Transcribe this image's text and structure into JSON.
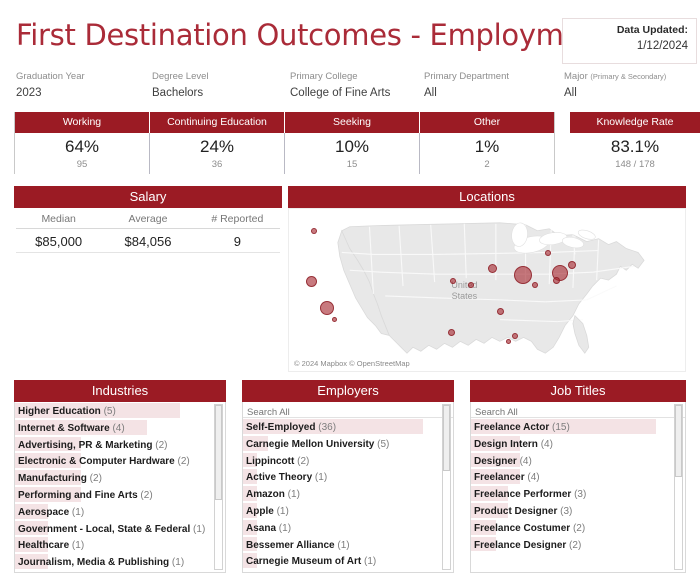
{
  "header": {
    "title": "First Destination Outcomes - Employment",
    "updated_label": "Data Updated:",
    "updated_value": "1/12/2024",
    "accent_red": "#9B1B24",
    "title_red": "#AA2B38",
    "highlight_pink": "#F4E3E5"
  },
  "filters": [
    {
      "label": "Graduation Year",
      "sub": "",
      "value": "2023"
    },
    {
      "label": "Degree Level",
      "sub": "",
      "value": "Bachelors"
    },
    {
      "label": "Primary College",
      "sub": "",
      "value": "College of Fine Arts"
    },
    {
      "label": "Primary Department",
      "sub": "",
      "value": "All"
    },
    {
      "label": "Major ",
      "sub": "(Primary & Secondary)",
      "value": "All"
    }
  ],
  "kpis": [
    {
      "name": "Working",
      "pct": "64%",
      "count": "95"
    },
    {
      "name": "Continuing Education",
      "pct": "24%",
      "count": "36"
    },
    {
      "name": "Seeking",
      "pct": "10%",
      "count": "15"
    },
    {
      "name": "Other",
      "pct": "1%",
      "count": "2"
    }
  ],
  "knowledge_rate": {
    "title": "Knowledge Rate",
    "pct": "83.1%",
    "count": "148 / 178"
  },
  "salary": {
    "title": "Salary",
    "columns": [
      "Median",
      "Average",
      "# Reported"
    ],
    "values": [
      "$85,000",
      "$84,056",
      "9"
    ]
  },
  "locations": {
    "title": "Locations",
    "attribution": "© 2024 Mapbox © OpenStreetMap",
    "map_label": "United\nStates",
    "map_label_line1": "United",
    "map_label_line2": "States"
  },
  "industries": {
    "title": "Industries",
    "has_search": false,
    "max_count": 5,
    "items": [
      {
        "label": "Higher Education",
        "count": 5
      },
      {
        "label": "Internet & Software",
        "count": 4
      },
      {
        "label": "Advertising, PR & Marketing",
        "count": 2
      },
      {
        "label": "Electronic & Computer Hardware",
        "count": 2
      },
      {
        "label": "Manufacturing",
        "count": 2
      },
      {
        "label": "Performing and Fine Arts",
        "count": 2
      },
      {
        "label": "Aerospace",
        "count": 1
      },
      {
        "label": "Government - Local, State & Federal",
        "count": 1
      },
      {
        "label": "Healthcare",
        "count": 1
      },
      {
        "label": "Journalism, Media & Publishing",
        "count": 1
      }
    ]
  },
  "employers": {
    "title": "Employers",
    "has_search": true,
    "search_placeholder": "Search All",
    "max_count": 36,
    "items": [
      {
        "label": "Self-Employed",
        "count": 36
      },
      {
        "label": "Carnegie Mellon University",
        "count": 5
      },
      {
        "label": "Lippincott",
        "count": 2
      },
      {
        "label": "Active Theory",
        "count": 1
      },
      {
        "label": "Amazon",
        "count": 1
      },
      {
        "label": "Apple",
        "count": 1
      },
      {
        "label": "Asana",
        "count": 1
      },
      {
        "label": "Bessemer Alliance",
        "count": 1
      },
      {
        "label": "Carnegie Museum of Art",
        "count": 1
      }
    ]
  },
  "job_titles": {
    "title": "Job Titles",
    "has_search": true,
    "search_placeholder": "Search All",
    "max_count": 15,
    "items": [
      {
        "label": "Freelance Actor",
        "count": 15
      },
      {
        "label": "Design Intern",
        "count": 4
      },
      {
        "label": "Designer",
        "count": 4
      },
      {
        "label": "Freelancer",
        "count": 4
      },
      {
        "label": "Freelance Performer",
        "count": 3
      },
      {
        "label": "Product Designer",
        "count": 3
      },
      {
        "label": "Freelance Costumer",
        "count": 2
      },
      {
        "label": "Freelance Designer",
        "count": 2
      }
    ]
  },
  "chart_data": {
    "type": "map",
    "title": "Locations",
    "projection": "usa",
    "points": [
      {
        "x": 6.2,
        "y": 13.5,
        "r": 3.0
      },
      {
        "x": 5.8,
        "y": 45.0,
        "r": 5.5
      },
      {
        "x": 9.5,
        "y": 61.0,
        "r": 7.0
      },
      {
        "x": 11.5,
        "y": 68.5,
        "r": 2.5
      },
      {
        "x": 41.5,
        "y": 44.5,
        "r": 3.0
      },
      {
        "x": 46.0,
        "y": 47.0,
        "r": 3.0
      },
      {
        "x": 41.0,
        "y": 76.5,
        "r": 3.5
      },
      {
        "x": 51.5,
        "y": 36.5,
        "r": 4.5
      },
      {
        "x": 53.5,
        "y": 63.0,
        "r": 3.5
      },
      {
        "x": 59.0,
        "y": 40.5,
        "r": 9.0
      },
      {
        "x": 62.0,
        "y": 47.0,
        "r": 3.0
      },
      {
        "x": 65.5,
        "y": 27.0,
        "r": 3.0
      },
      {
        "x": 68.5,
        "y": 39.5,
        "r": 8.0
      },
      {
        "x": 67.5,
        "y": 44.0,
        "r": 3.5
      },
      {
        "x": 71.5,
        "y": 34.5,
        "r": 4.0
      },
      {
        "x": 55.5,
        "y": 81.5,
        "r": 2.5
      },
      {
        "x": 57.0,
        "y": 78.5,
        "r": 3.0
      }
    ]
  }
}
